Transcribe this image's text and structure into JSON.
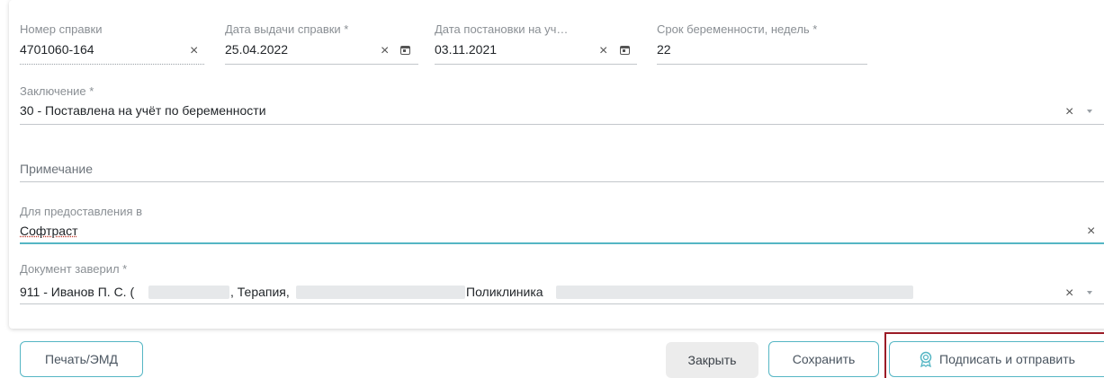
{
  "fields": {
    "cert_number": {
      "label": "Номер справки",
      "value": "4701060-164"
    },
    "issue_date": {
      "label": "Дата выдачи справки *",
      "value": "25.04.2022"
    },
    "registration_date": {
      "label": "Дата постановки на уч…",
      "value": "03.11.2021"
    },
    "pregnancy_term": {
      "label": "Срок беременности, недель *",
      "value": "22"
    },
    "conclusion": {
      "label": "Заключение *",
      "value": "30 - Поставлена на учёт по беременности"
    },
    "note": {
      "label": "Примечание",
      "value": ""
    },
    "provide_to": {
      "label": "Для предоставления в",
      "value": "Софтраст"
    },
    "certified_by": {
      "label": "Документ заверил *",
      "value_prefix": "911 -  Иванов П. С. (",
      "value_mid": ", Терапия,",
      "value_org": "Поликлиника"
    }
  },
  "icons": {
    "clear": "×"
  },
  "buttons": {
    "print": "Печать/ЭМД",
    "close": "Закрыть",
    "save": "Сохранить",
    "sign_send": "Подписать и отправить"
  },
  "colors": {
    "accent": "#55b6c4",
    "highlight_frame": "#9b1b26",
    "focus_underline": "#55b6c4"
  }
}
